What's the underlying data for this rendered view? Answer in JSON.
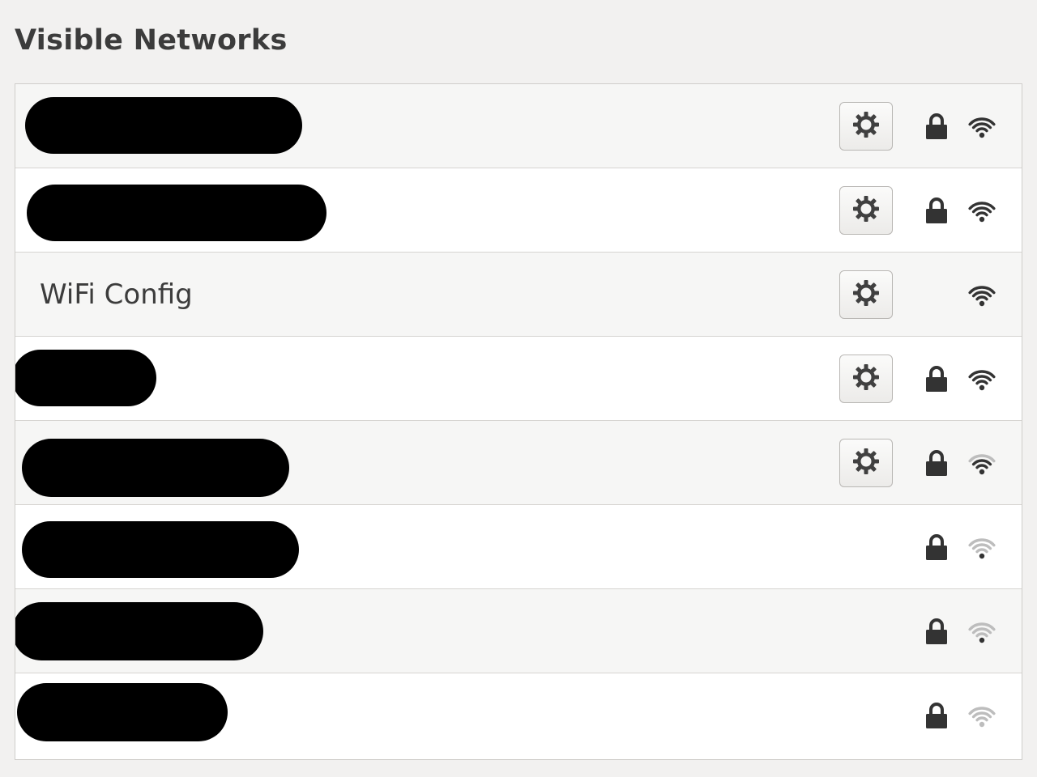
{
  "section": {
    "title": "Visible Networks"
  },
  "networks": [
    {
      "ssid": "",
      "redacted": true,
      "has_settings": true,
      "secured": true,
      "signal": 4
    },
    {
      "ssid": "",
      "redacted": true,
      "has_settings": true,
      "secured": true,
      "signal": 4
    },
    {
      "ssid": "WiFi Config",
      "redacted": false,
      "has_settings": true,
      "secured": false,
      "signal": 4
    },
    {
      "ssid": "",
      "redacted": true,
      "has_settings": true,
      "secured": true,
      "signal": 4
    },
    {
      "ssid": "",
      "redacted": true,
      "has_settings": true,
      "secured": true,
      "signal": 3
    },
    {
      "ssid": "",
      "redacted": true,
      "has_settings": false,
      "secured": true,
      "signal": 1
    },
    {
      "ssid": "",
      "redacted": true,
      "has_settings": false,
      "secured": true,
      "signal": 1
    },
    {
      "ssid": "",
      "redacted": true,
      "has_settings": false,
      "secured": true,
      "signal": 0
    }
  ],
  "icons": {
    "settings": "gear-icon",
    "lock": "lock-icon",
    "signal": "wifi-signal-icon"
  },
  "colors": {
    "icon_dark": "#333333",
    "icon_faded": "#bdbdbd",
    "redaction": "#000000"
  }
}
